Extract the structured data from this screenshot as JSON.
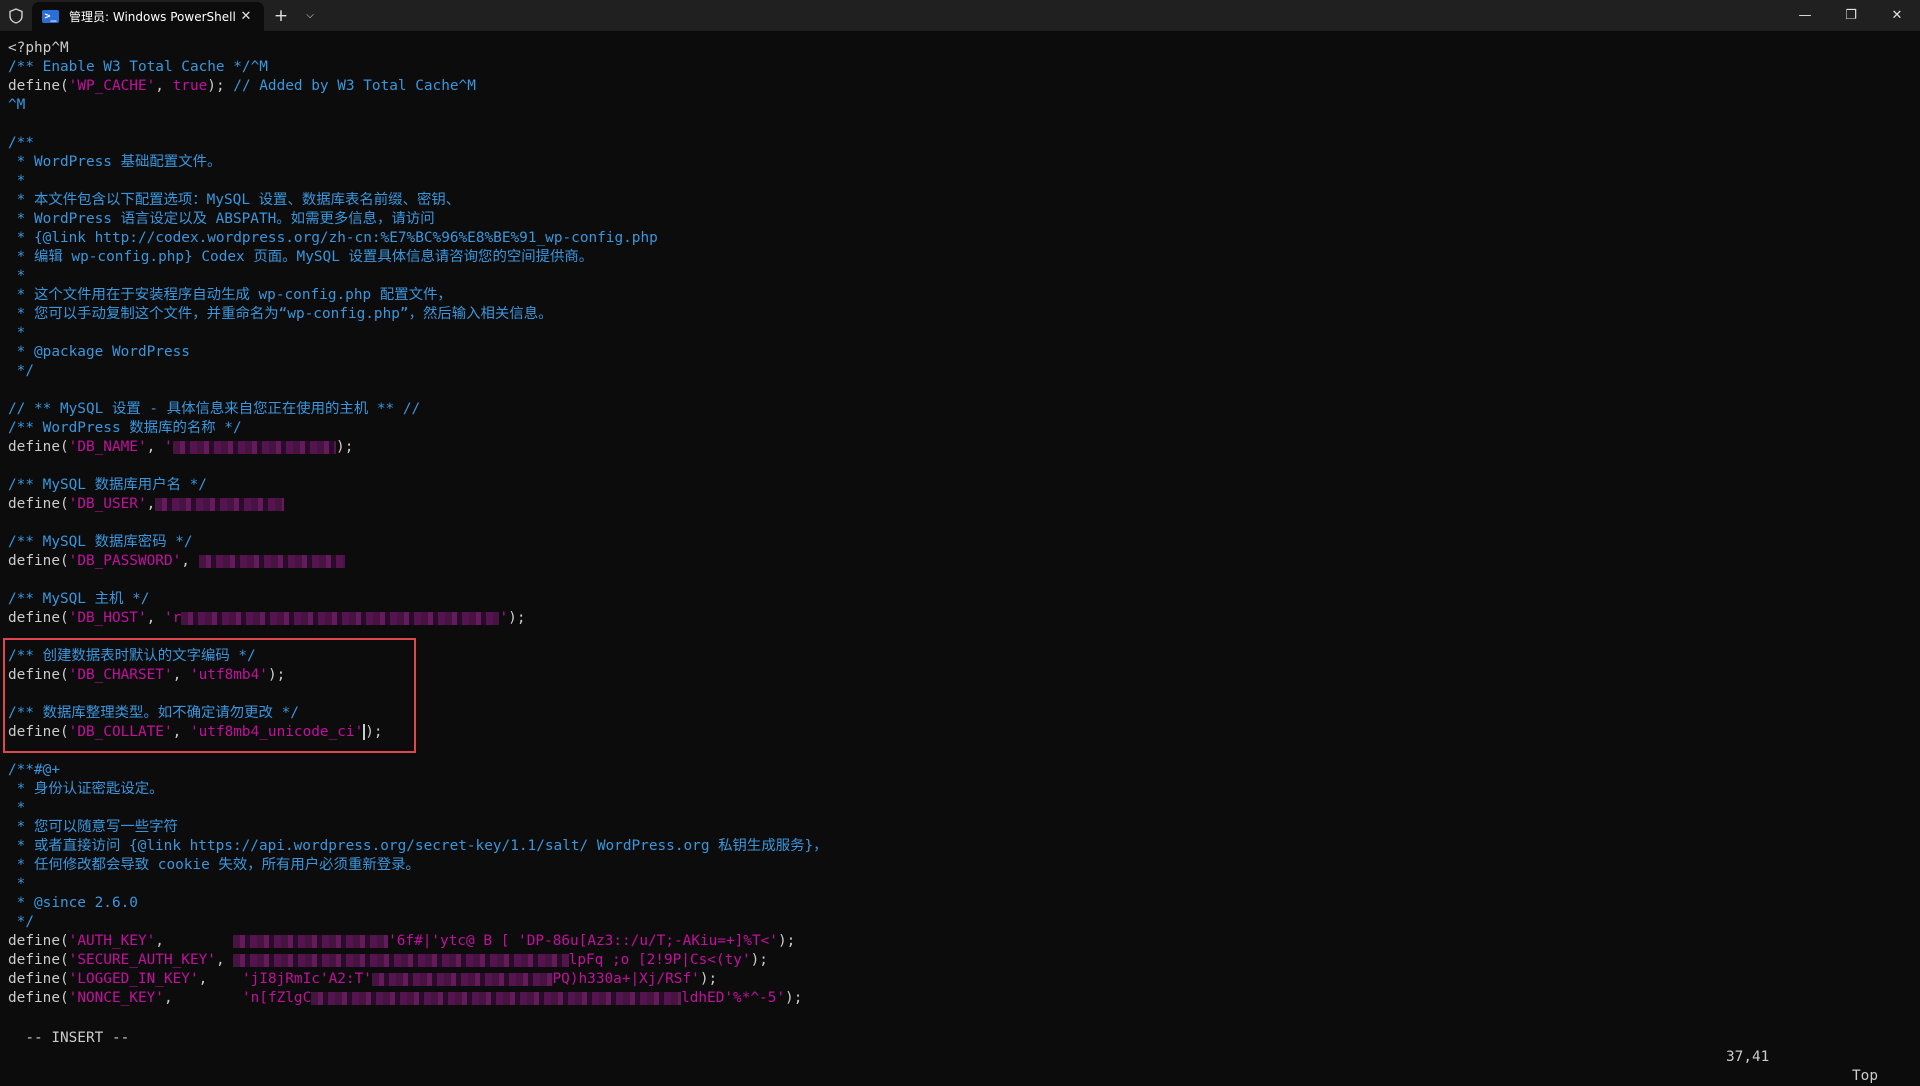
{
  "titlebar": {
    "tab_title": "管理员: Windows PowerShell",
    "new_tab": "+",
    "dropdown": "⌵",
    "close_tab": "✕",
    "minimize": "—",
    "restore": "❐",
    "close": "✕"
  },
  "lines": [
    [
      [
        "k",
        "<?php^M"
      ]
    ],
    [
      [
        "c",
        "/** Enable W3 Total Cache */^M"
      ]
    ],
    [
      [
        "k",
        "define("
      ],
      [
        "s",
        "'WP_CACHE'"
      ],
      [
        "k",
        ", "
      ],
      [
        "s",
        "true"
      ],
      [
        "k",
        "); "
      ],
      [
        "c",
        "// Added by W3 Total Cache^M"
      ]
    ],
    [
      [
        "c",
        "^M"
      ]
    ],
    [
      [
        "k",
        ""
      ]
    ],
    [
      [
        "c",
        "/**"
      ]
    ],
    [
      [
        "c",
        " * WordPress 基础配置文件。"
      ]
    ],
    [
      [
        "c",
        " *"
      ]
    ],
    [
      [
        "c",
        " * 本文件包含以下配置选项：MySQL 设置、数据库表名前缀、密钥、"
      ]
    ],
    [
      [
        "c",
        " * WordPress 语言设定以及 ABSPATH。如需更多信息，请访问"
      ]
    ],
    [
      [
        "c",
        " * {@link http://codex.wordpress.org/zh-cn:%E7%BC%96%E8%BE%91_wp-config.php"
      ]
    ],
    [
      [
        "c",
        " * 编辑 wp-config.php} Codex 页面。MySQL 设置具体信息请咨询您的空间提供商。"
      ]
    ],
    [
      [
        "c",
        " *"
      ]
    ],
    [
      [
        "c",
        " * 这个文件用在于安装程序自动生成 wp-config.php 配置文件，"
      ]
    ],
    [
      [
        "c",
        " * 您可以手动复制这个文件，并重命名为“wp-config.php”，然后输入相关信息。"
      ]
    ],
    [
      [
        "c",
        " *"
      ]
    ],
    [
      [
        "c",
        " * @package WordPress"
      ]
    ],
    [
      [
        "c",
        " */"
      ]
    ],
    [
      [
        "k",
        ""
      ]
    ],
    [
      [
        "c",
        "// ** MySQL 设置 - 具体信息来自您正在使用的主机 ** //"
      ]
    ],
    [
      [
        "c",
        "/** WordPress 数据库的名称 */"
      ]
    ],
    [
      [
        "k",
        "define("
      ],
      [
        "s",
        "'DB_NAME'"
      ],
      [
        "k",
        ", "
      ],
      [
        "s",
        "'"
      ],
      [
        "blur",
        "19"
      ],
      [
        "k",
        ");"
      ]
    ],
    [
      [
        "k",
        ""
      ]
    ],
    [
      [
        "c",
        "/** MySQL 数据库用户名 */"
      ]
    ],
    [
      [
        "k",
        "define("
      ],
      [
        "s",
        "'DB_USER'"
      ],
      [
        "k",
        ","
      ],
      [
        "blur",
        "15"
      ]
    ],
    [
      [
        "k",
        ""
      ]
    ],
    [
      [
        "c",
        "/** MySQL 数据库密码 */"
      ]
    ],
    [
      [
        "k",
        "define("
      ],
      [
        "s",
        "'DB_PASSWORD'"
      ],
      [
        "k",
        ", "
      ],
      [
        "blur",
        "17"
      ]
    ],
    [
      [
        "k",
        ""
      ]
    ],
    [
      [
        "c",
        "/** MySQL 主机 */"
      ]
    ],
    [
      [
        "k",
        "define("
      ],
      [
        "s",
        "'DB_HOST'"
      ],
      [
        "k",
        ", "
      ],
      [
        "s",
        "'r"
      ],
      [
        "blur",
        "37"
      ],
      [
        "s",
        "'"
      ],
      [
        "k",
        ");"
      ]
    ],
    [
      [
        "k",
        ""
      ]
    ],
    [
      [
        "c",
        "/** 创建数据表时默认的文字编码 */"
      ]
    ],
    [
      [
        "k",
        "define("
      ],
      [
        "s",
        "'DB_CHARSET'"
      ],
      [
        "k",
        ", "
      ],
      [
        "s",
        "'utf8mb4'"
      ],
      [
        "k",
        ");"
      ]
    ],
    [
      [
        "k",
        ""
      ]
    ],
    [
      [
        "c",
        "/** 数据库整理类型。如不确定请勿更改 */"
      ]
    ],
    [
      [
        "k",
        "define("
      ],
      [
        "s",
        "'DB_COLLATE'"
      ],
      [
        "k",
        ", "
      ],
      [
        "s",
        "'utf8mb4_unicode_ci"
      ],
      [
        "cur",
        "'"
      ],
      [
        "k",
        ");"
      ]
    ],
    [
      [
        "k",
        ""
      ]
    ],
    [
      [
        "c",
        "/**#@+"
      ]
    ],
    [
      [
        "c",
        " * 身份认证密匙设定。"
      ]
    ],
    [
      [
        "c",
        " *"
      ]
    ],
    [
      [
        "c",
        " * 您可以随意写一些字符"
      ]
    ],
    [
      [
        "c",
        " * 或者直接访问 {@link https://api.wordpress.org/secret-key/1.1/salt/ WordPress.org 私钥生成服务}，"
      ]
    ],
    [
      [
        "c",
        " * 任何修改都会导致 cookie 失效，所有用户必须重新登录。"
      ]
    ],
    [
      [
        "c",
        " *"
      ]
    ],
    [
      [
        "c",
        " * @since 2.6.0"
      ]
    ],
    [
      [
        "c",
        " */"
      ]
    ],
    [
      [
        "k",
        "define("
      ],
      [
        "s",
        "'AUTH_KEY'"
      ],
      [
        "k",
        ",        "
      ],
      [
        "blur",
        "18"
      ],
      [
        "s",
        "'6f#|'ytc@ B [ 'DP-86u[Az3::/u/T;-AKiu=+]%T<'"
      ],
      [
        "k",
        ");"
      ]
    ],
    [
      [
        "k",
        "define("
      ],
      [
        "s",
        "'SECURE_AUTH_KEY'"
      ],
      [
        "k",
        ", "
      ],
      [
        "blur",
        "39"
      ],
      [
        "s",
        "lpFq ;o [2!9P|Cs<(ty'"
      ],
      [
        "k",
        ");"
      ]
    ],
    [
      [
        "k",
        "define("
      ],
      [
        "s",
        "'LOGGED_IN_KEY'"
      ],
      [
        "k",
        ",    "
      ],
      [
        "s",
        "'jI8jRmIc'A2:T'"
      ],
      [
        "blur",
        "21"
      ],
      [
        "s",
        "PQ)h330a+|Xj/RSf'"
      ],
      [
        "k",
        ");"
      ]
    ],
    [
      [
        "k",
        "define("
      ],
      [
        "s",
        "'NONCE_KEY'"
      ],
      [
        "k",
        ",        "
      ],
      [
        "s",
        "'n[fZlgC"
      ],
      [
        "blur",
        "43"
      ],
      [
        "s",
        "ldhED'%*^-5'"
      ],
      [
        "k",
        ");"
      ]
    ]
  ],
  "statusbar": {
    "mode": "-- INSERT --",
    "position": "37,41",
    "scroll": "Top"
  }
}
